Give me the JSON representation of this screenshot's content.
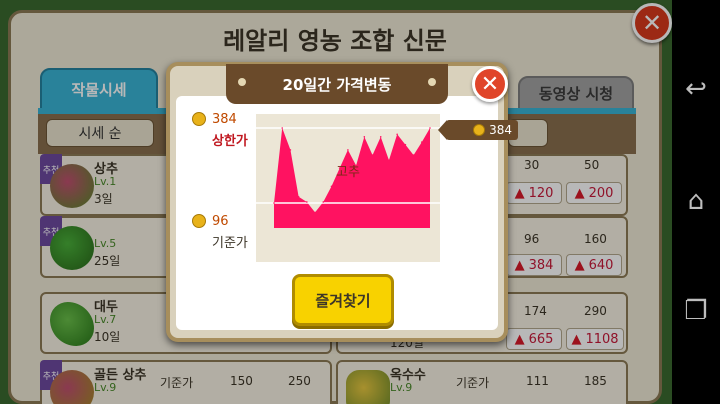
{
  "paper": {
    "title": "레알리 영농 조합 신문"
  },
  "tabs": {
    "market": "작물시세",
    "video": "동영상 시청"
  },
  "sort": {
    "label": "시세 순"
  },
  "rows_left": [
    {
      "name": "상추",
      "level": "Lv.1",
      "days": "3일",
      "ribbon": "추천"
    },
    {
      "name": "",
      "level": "Lv.5",
      "days": "25일",
      "ribbon": "추천"
    },
    {
      "name": "대두",
      "level": "Lv.7",
      "days": "10일",
      "ribbon": ""
    },
    {
      "name": "골든 상추",
      "level": "Lv.9",
      "days": "",
      "ribbon": "추천",
      "label_base": "기준가",
      "base": "150",
      "upper": "250"
    }
  ],
  "rows_right": [
    {
      "base": "30",
      "upper": "50",
      "cur_low": "120",
      "cur_high": "200"
    },
    {
      "base": "96",
      "upper": "160",
      "cur_low": "384",
      "cur_high": "640"
    },
    {
      "base": "174",
      "upper": "290",
      "cur_low": "665",
      "cur_high": "1108",
      "days": "120일"
    },
    {
      "name": "옥수수",
      "level": "Lv.9",
      "label_base": "기준가",
      "base": "111",
      "upper": "185"
    }
  ],
  "popup": {
    "title": "20일간 가격변동",
    "upper_value": "384",
    "upper_label": "상한가",
    "base_value": "96",
    "base_label": "기준가",
    "current_value": "384",
    "center_label": "고추",
    "favorite_button": "즐겨찾기"
  },
  "chart_data": {
    "type": "area",
    "title": "20일간 가격변동",
    "x": [
      1,
      2,
      3,
      4,
      5,
      6,
      7,
      8,
      9,
      10,
      11,
      12,
      13,
      14,
      15,
      16,
      17,
      18,
      19,
      20
    ],
    "values": [
      96,
      384,
      300,
      120,
      100,
      60,
      100,
      160,
      230,
      300,
      240,
      350,
      280,
      350,
      260,
      360,
      320,
      280,
      330,
      384
    ],
    "ylim": [
      0,
      384
    ],
    "reference_lines": [
      {
        "label": "상한가",
        "value": 384
      },
      {
        "label": "기준가",
        "value": 96
      }
    ],
    "color": "#ff1261"
  },
  "colors": {
    "accent": "#39b4d6",
    "chart_fill": "#ff1261",
    "button": "#f8d200",
    "close": "#e0452a"
  }
}
